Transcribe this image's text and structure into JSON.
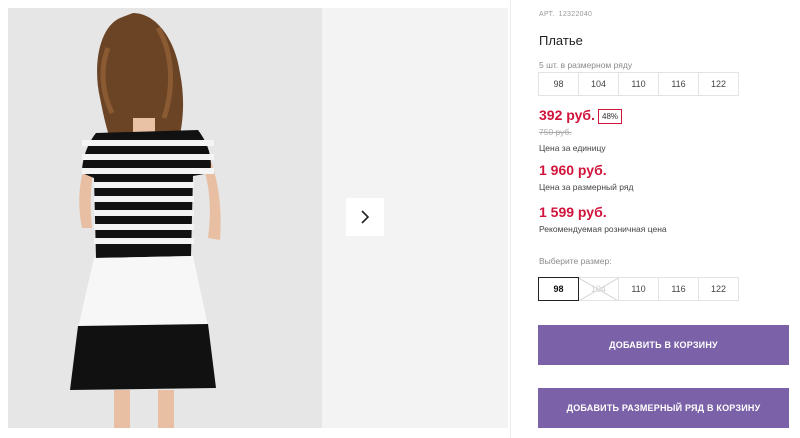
{
  "gallery": {
    "photo_alt": "girl-in-striped-dress",
    "next_icon": "chevron-right-icon"
  },
  "product": {
    "article_label": "АРТ.",
    "article_number": "12322040",
    "title": "Платье",
    "pack_note": "5 шт. в размерном ряду",
    "pack_sizes": [
      "98",
      "104",
      "110",
      "116",
      "122"
    ],
    "price": "392 руб.",
    "discount_badge": "48%",
    "old_price": "750 руб.",
    "price_note": "Цена за единицу",
    "set_price": "1 960 руб.",
    "set_price_note": "Цена за размерный ряд",
    "retail_price": "1 599 руб.",
    "retail_price_note": "Рекомендуемая розничная цена",
    "choose_size_label": "Выберите размер:",
    "size_options": [
      {
        "label": "98",
        "state": "selected"
      },
      {
        "label": "104",
        "state": "unavailable"
      },
      {
        "label": "110",
        "state": "available"
      },
      {
        "label": "116",
        "state": "available"
      },
      {
        "label": "122",
        "state": "available"
      }
    ],
    "add_to_cart": "ДОБАВИТЬ В КОРЗИНУ",
    "add_set_to_cart": "ДОБАВИТЬ РАЗМЕРНЫЙ РЯД В КОРЗИНУ"
  },
  "colors": {
    "price_red": "#d0143c",
    "button_purple": "#7b62a8"
  }
}
